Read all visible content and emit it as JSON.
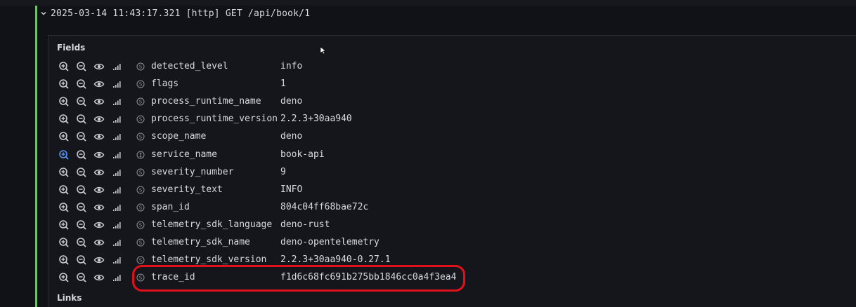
{
  "log_entry": {
    "text": "2025-03-14 11:43:17.321 [http] GET /api/book/1"
  },
  "fields_section": {
    "title": "Fields",
    "rows": [
      {
        "name": "detected_level",
        "value": "info",
        "type": "string"
      },
      {
        "name": "flags",
        "value": "1",
        "type": "string"
      },
      {
        "name": "process_runtime_name",
        "value": "deno",
        "type": "string"
      },
      {
        "name": "process_runtime_version",
        "value": "2.2.3+30aa940",
        "type": "string"
      },
      {
        "name": "scope_name",
        "value": "deno",
        "type": "string"
      },
      {
        "name": "service_name",
        "value": "book-api",
        "type": "indexed"
      },
      {
        "name": "severity_number",
        "value": "9",
        "type": "string"
      },
      {
        "name": "severity_text",
        "value": "INFO",
        "type": "string"
      },
      {
        "name": "span_id",
        "value": "804c04ff68bae72c",
        "type": "string"
      },
      {
        "name": "telemetry_sdk_language",
        "value": "deno-rust",
        "type": "string"
      },
      {
        "name": "telemetry_sdk_name",
        "value": "deno-opentelemetry",
        "type": "string"
      },
      {
        "name": "telemetry_sdk_version",
        "value": "2.2.3+30aa940-0.27.1",
        "type": "string"
      },
      {
        "name": "trace_id",
        "value": "f1d6c68fc691b275bb1846cc0a4f3ea4",
        "type": "string"
      }
    ]
  },
  "links_section": {
    "title": "Links"
  },
  "icons": {
    "row_actions": [
      "zoom-in-icon",
      "zoom-out-icon",
      "eye-icon",
      "stats-icon"
    ],
    "string_type": "string-type-icon",
    "indexed_type": "indexed-type-icon"
  },
  "colors": {
    "background": "#111217",
    "panel": "#15161b",
    "accent_green": "#73bf69",
    "highlight_red": "#e0111a",
    "active_icon_blue": "#5794f2"
  }
}
